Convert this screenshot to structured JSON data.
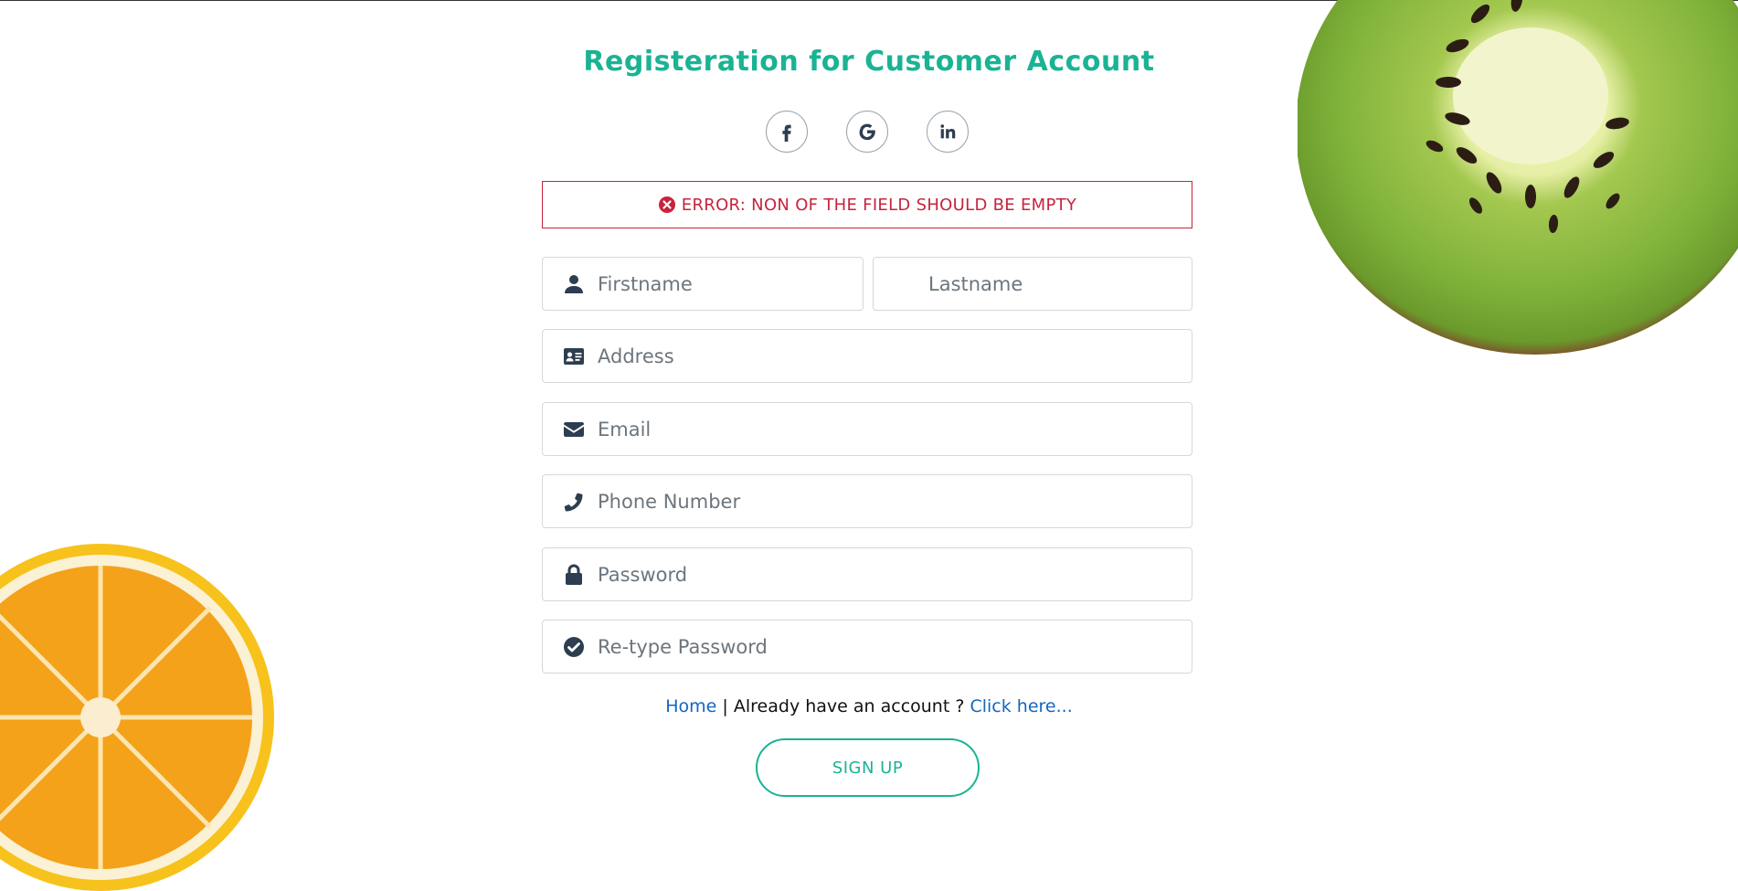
{
  "title": "Registeration for Customer Account",
  "social": [
    {
      "name": "facebook",
      "icon": "facebook-icon"
    },
    {
      "name": "google",
      "icon": "google-icon"
    },
    {
      "name": "linkedin",
      "icon": "linkedin-icon"
    }
  ],
  "error": {
    "icon": "error-circle-icon",
    "message": "ERROR: NON OF THE FIELD SHOULD BE EMPTY"
  },
  "form": {
    "firstname": {
      "placeholder": "Firstname",
      "value": "",
      "icon": "user-icon"
    },
    "lastname": {
      "placeholder": "Lastname",
      "value": ""
    },
    "address": {
      "placeholder": "Address",
      "value": "",
      "icon": "address-card-icon"
    },
    "email": {
      "placeholder": "Email",
      "value": "",
      "icon": "envelope-icon"
    },
    "phone": {
      "placeholder": "Phone Number",
      "value": "",
      "icon": "phone-icon"
    },
    "password": {
      "placeholder": "Password",
      "value": "",
      "icon": "lock-icon"
    },
    "retype_password": {
      "placeholder": "Re-type Password",
      "value": "",
      "icon": "check-circle-icon"
    }
  },
  "links": {
    "home": "Home",
    "separator": "|",
    "already": "Already have an account ?",
    "click_here": "Click here..."
  },
  "signup_label": "SIGN UP",
  "colors": {
    "accent": "#1ab394",
    "error": "#c8233d",
    "link": "#1565c0",
    "icon": "#2c3e50"
  }
}
